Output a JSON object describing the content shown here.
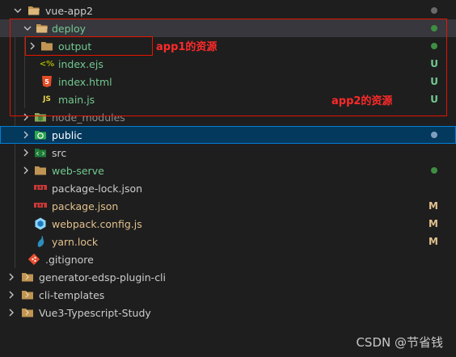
{
  "colors": {
    "folder": "#c09553",
    "untracked": "#73c991",
    "modified": "#e2c08d",
    "ignored": "#8c8c8c",
    "annotation": "#e51400",
    "dot_green": "#3e8e41",
    "dot_gray": "#6a6a6a",
    "selected_bg": "#04395e"
  },
  "tree": {
    "rows": [
      {
        "label": "vue-app2",
        "icon": "folder-open-icon",
        "badge": "",
        "indicator": "dot"
      },
      {
        "label": "deploy",
        "icon": "folder-open-icon",
        "badge": "",
        "indicator": "dot"
      },
      {
        "label": "output",
        "icon": "folder-icon",
        "badge": "",
        "indicator": "dot"
      },
      {
        "label": "index.ejs",
        "icon": "ejs-icon",
        "icon_text": "<%",
        "badge": "U"
      },
      {
        "label": "index.html",
        "icon": "html5-icon",
        "icon_text": "5",
        "badge": "U"
      },
      {
        "label": "main.js",
        "icon": "js-icon",
        "icon_text": "JS",
        "badge": "U"
      },
      {
        "label": "node_modules",
        "icon": "node-modules-folder-icon",
        "badge": ""
      },
      {
        "label": "public",
        "icon": "public-folder-icon",
        "badge": "",
        "indicator": "dot"
      },
      {
        "label": "src",
        "icon": "src-folder-icon",
        "badge": ""
      },
      {
        "label": "web-serve",
        "icon": "folder-icon",
        "badge": "",
        "indicator": "dot"
      },
      {
        "label": "package-lock.json",
        "icon": "npm-icon",
        "badge": ""
      },
      {
        "label": "package.json",
        "icon": "npm-icon",
        "badge": "M"
      },
      {
        "label": "webpack.config.js",
        "icon": "webpack-icon",
        "badge": "M"
      },
      {
        "label": "yarn.lock",
        "icon": "yarn-icon",
        "badge": "M"
      },
      {
        "label": ".gitignore",
        "icon": "git-icon",
        "badge": ""
      },
      {
        "label": "generator-edsp-plugin-cli",
        "icon": "folder-icon",
        "badge": ""
      },
      {
        "label": "cli-templates",
        "icon": "folder-icon",
        "badge": ""
      },
      {
        "label": "Vue3-Typescript-Study",
        "icon": "folder-icon",
        "badge": ""
      }
    ]
  },
  "annotations": {
    "app1": "app1的资源",
    "app2": "app2的资源"
  },
  "watermark": "CSDN @节省钱"
}
